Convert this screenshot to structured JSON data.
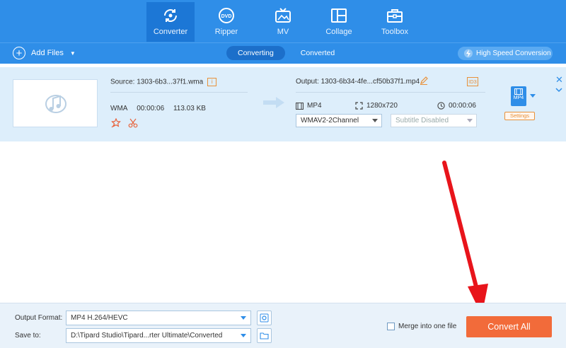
{
  "nav": {
    "items": [
      {
        "label": "Converter",
        "icon": "converter-icon",
        "active": true
      },
      {
        "label": "Ripper",
        "icon": "dvd-icon",
        "active": false
      },
      {
        "label": "MV",
        "icon": "tv-icon",
        "active": false
      },
      {
        "label": "Collage",
        "icon": "collage-icon",
        "active": false
      },
      {
        "label": "Toolbox",
        "icon": "toolbox-icon",
        "active": false
      }
    ]
  },
  "toolbar": {
    "add_files": "Add Files",
    "tabs": [
      {
        "label": "Converting",
        "active": true
      },
      {
        "label": "Converted",
        "active": false
      }
    ],
    "high_speed": "High Speed Conversion"
  },
  "file": {
    "source": "Source: 1303-6b3...37f1.wma",
    "info_badge": "i",
    "format": "WMA",
    "duration": "00:00:06",
    "size": "113.03 KB",
    "output": "Output: 1303-6b34-4fe...cf50b37f1.mp4",
    "id3_badge": "ID3",
    "out_format": "MP4",
    "resolution": "1280x720",
    "out_duration": "00:00:06",
    "audio_track": "WMAV2-2Channel",
    "subtitle": "Subtitle Disabled",
    "format_badge": "MP4",
    "settings": "Settings"
  },
  "bottom": {
    "output_format_label": "Output Format:",
    "output_format_value": "MP4 H.264/HEVC",
    "save_to_label": "Save to:",
    "save_to_value": "D:\\Tipard Studio\\Tipard...rter Ultimate\\Converted",
    "merge_label": "Merge into one file",
    "merge_checked": false,
    "convert_all": "Convert All"
  },
  "colors": {
    "nav_bg": "#2f8ee8",
    "accent_orange": "#f26b3a",
    "annotation_red": "#e8141b"
  }
}
